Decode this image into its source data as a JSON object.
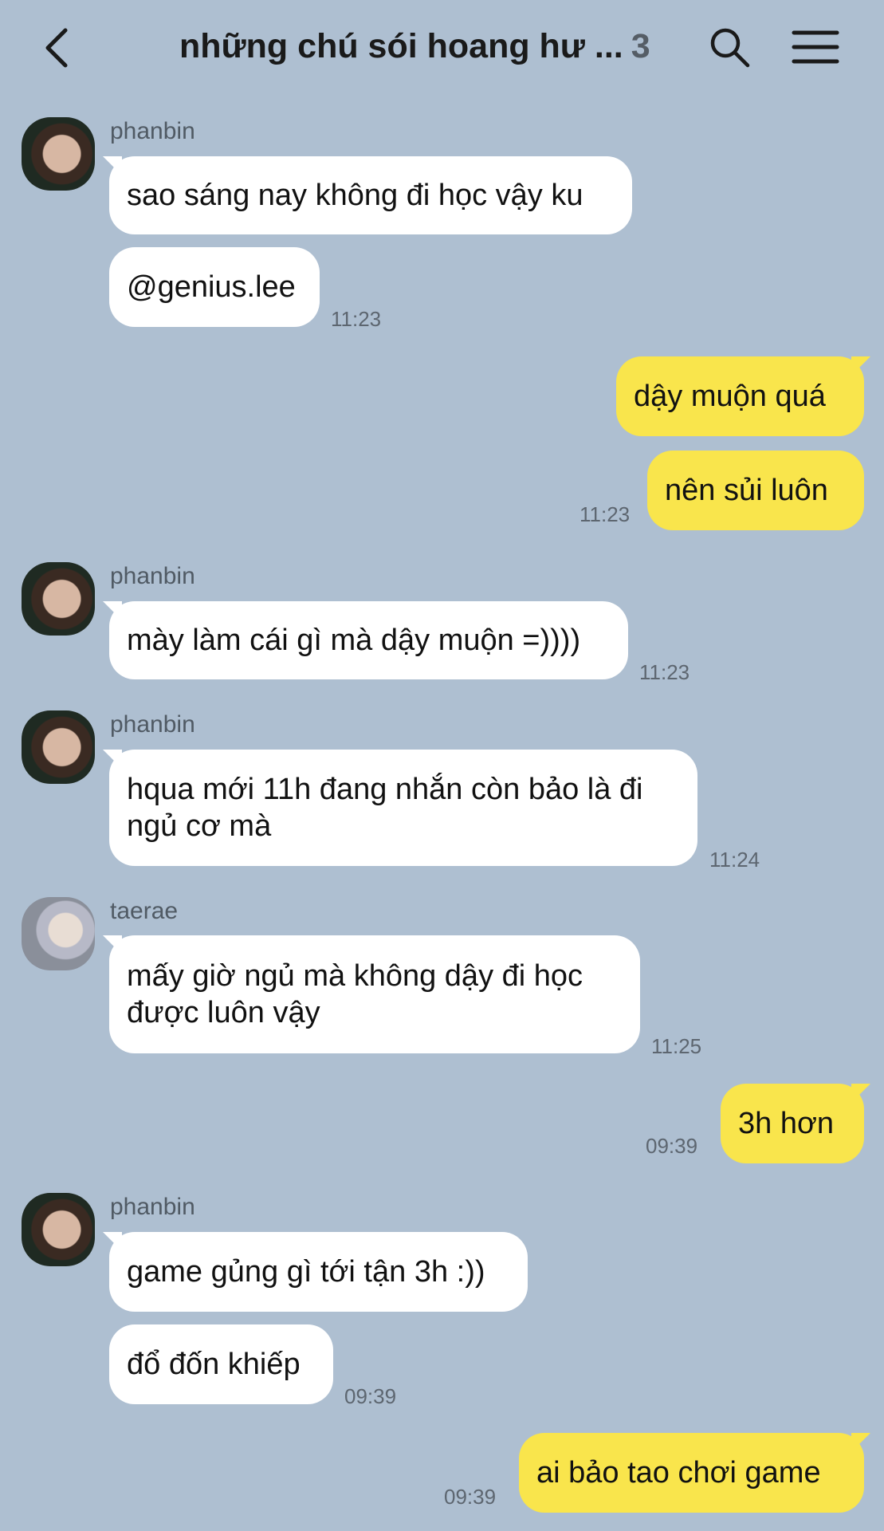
{
  "header": {
    "title": "những chú sói hoang hư ...",
    "member_count": "3"
  },
  "messages": [
    {
      "sender": "phanbin",
      "text": "sao sáng nay không đi học vậy ku"
    },
    {
      "text": "@genius.lee",
      "time": "11:23"
    },
    {
      "text": "dậy muộn quá"
    },
    {
      "text": "nên sủi luôn",
      "time": "11:23"
    },
    {
      "sender": "phanbin",
      "text": "mày làm cái gì mà dậy muộn =))))",
      "time": "11:23"
    },
    {
      "sender": "phanbin",
      "text": "hqua mới 11h đang nhắn còn bảo là đi ngủ cơ mà",
      "time": "11:24"
    },
    {
      "sender": "taerae",
      "text": "mấy giờ ngủ mà không dậy đi học được luôn vậy",
      "time": "11:25"
    },
    {
      "text": "3h hơn",
      "time": "09:39"
    },
    {
      "sender": "phanbin",
      "text": "game gủng gì tới tận 3h :))"
    },
    {
      "text": "đổ đốn khiếp",
      "time": "09:39"
    },
    {
      "text": "ai bảo tao chơi game",
      "time": "09:39"
    }
  ]
}
